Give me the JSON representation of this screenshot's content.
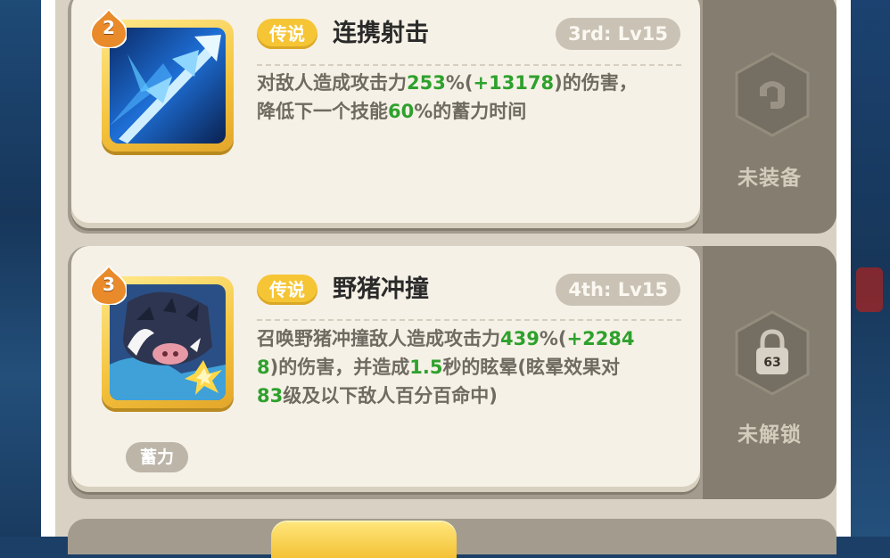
{
  "skills": [
    {
      "number": "2",
      "rarity": "传说",
      "name": "连携射击",
      "level": "3rd: Lv15",
      "desc_lines": [
        [
          {
            "t": "对敌人造成攻击力",
            "g": false
          },
          {
            "t": "253",
            "g": true
          },
          {
            "t": "%(",
            "g": false
          },
          {
            "t": "+13178",
            "g": true
          },
          {
            "t": ")的伤害，",
            "g": false
          }
        ],
        [
          {
            "t": "降低下一个技能",
            "g": false
          },
          {
            "t": "60",
            "g": true
          },
          {
            "t": "%的蓄力时间",
            "g": false
          }
        ]
      ],
      "side_status": "未装备",
      "side_icon": "equip-hook-icon"
    },
    {
      "number": "3",
      "rarity": "传说",
      "name": "野猪冲撞",
      "level": "4th: Lv15",
      "desc_lines": [
        [
          {
            "t": "召唤野猪冲撞敌人造成攻击力",
            "g": false
          },
          {
            "t": "439",
            "g": true
          },
          {
            "t": "%(",
            "g": false
          },
          {
            "t": "+2284",
            "g": true
          }
        ],
        [
          {
            "t": "8",
            "g": true
          },
          {
            "t": ")的伤害，并造成",
            "g": false
          },
          {
            "t": "1.5",
            "g": true
          },
          {
            "t": "秒的眩晕(眩晕效果对",
            "g": false
          }
        ],
        [
          {
            "t": "83",
            "g": true
          },
          {
            "t": "级及以下敌人百分百命中)",
            "g": false
          }
        ]
      ],
      "tag": "蓄力",
      "side_status": "未解锁",
      "side_icon": "lock-icon",
      "unlock_level": "63"
    }
  ],
  "colors": {
    "highlight_green": "#2ea12d",
    "rarity_gold": "#f5c535",
    "desc_text": "#6f6a62"
  }
}
